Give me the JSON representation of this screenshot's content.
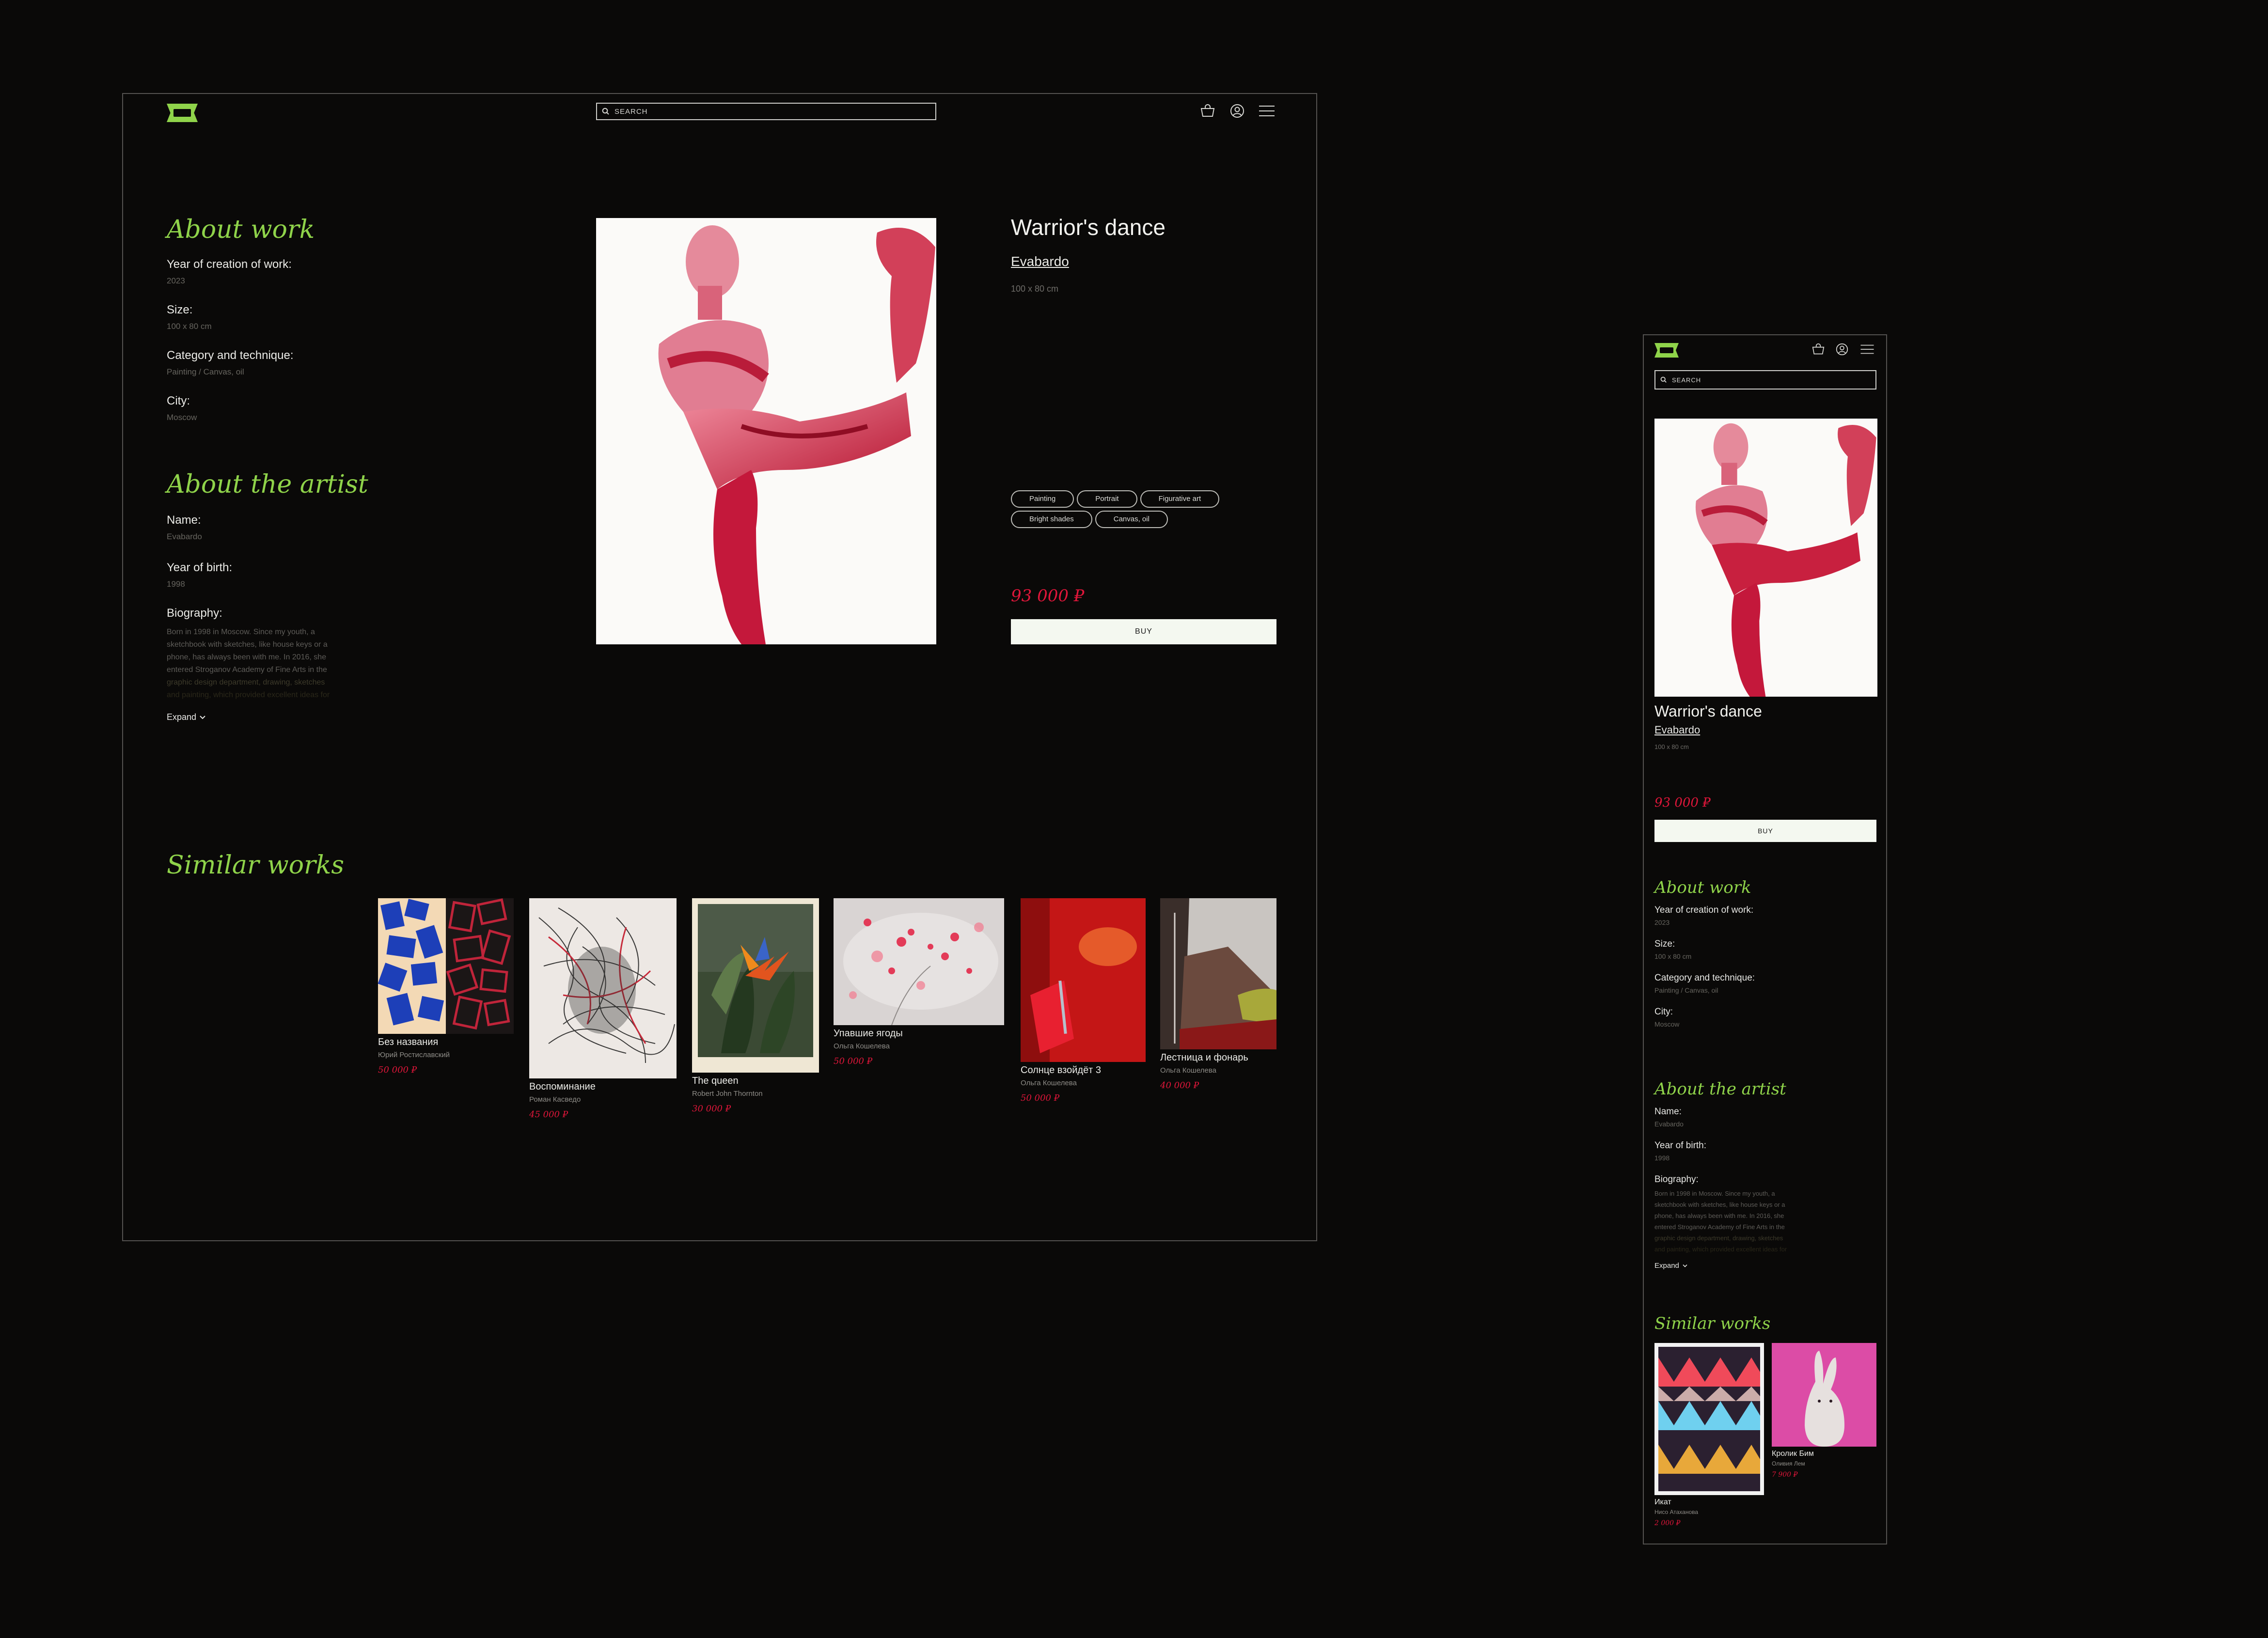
{
  "search": {
    "placeholder": "SEARCH"
  },
  "artwork": {
    "title": "Warrior's dance",
    "artist": "Evabardo",
    "size": "100 x 80 cm",
    "tags": [
      "Painting",
      "Portrait",
      "Figurative art",
      "Bright shades",
      "Canvas, oil"
    ],
    "price": "93 000 ₽",
    "buy_label": "BUY"
  },
  "about_work": {
    "heading": "About work",
    "year_label": "Year of creation of work:",
    "year_value": "2023",
    "size_label": "Size:",
    "size_value": "100 x 80 cm",
    "category_label": "Category and technique:",
    "category_value": "Painting / Canvas, oil",
    "city_label": "City:",
    "city_value": "Moscow"
  },
  "about_artist": {
    "heading": "About the artist",
    "name_label": "Name:",
    "name_value": "Evabardo",
    "birth_label": "Year of birth:",
    "birth_value": "1998",
    "bio_label": "Biography:",
    "bio_lines": [
      "Born in 1998 in Moscow. Since my youth, a",
      "sketchbook with sketches, like house keys or a",
      "phone, has always been with me. In 2016, she",
      "entered Stroganov Academy of Fine Arts in the",
      "graphic design department, drawing, sketches",
      "and painting, which provided excellent ideas for"
    ],
    "expand_label": "Expand"
  },
  "similar": {
    "heading": "Similar works",
    "items": [
      {
        "title": "Без названия",
        "author": "Юрий Ростиславский",
        "price": "50 000 ₽"
      },
      {
        "title": "Воспоминание",
        "author": "Роман Касведо",
        "price": "45 000 ₽"
      },
      {
        "title": "The queen",
        "author": "Robert John Thornton",
        "price": "30 000 ₽"
      },
      {
        "title": "Упавшие ягоды",
        "author": "Ольга Кошелева",
        "price": "50 000 ₽"
      },
      {
        "title": "Солнце взойдёт 3",
        "author": "Ольга Кошелева",
        "price": "50 000 ₽"
      },
      {
        "title": "Лестница и фонарь",
        "author": "Ольга Кошелева",
        "price": "40 000 ₽"
      }
    ],
    "mobile_items": [
      {
        "title": "Икат",
        "author": "Нисо Атаханова",
        "price": "2 000 ₽"
      },
      {
        "title": "Кролик Бим",
        "author": "Оливия Лем",
        "price": "7 900 ₽"
      }
    ]
  },
  "colors": {
    "accent": "#8fd34a",
    "price": "#e0163a",
    "background": "#0a0908"
  },
  "icons": [
    "logo-icon",
    "search-icon",
    "cart-icon",
    "user-icon",
    "menu-icon",
    "chevron-down-icon"
  ]
}
